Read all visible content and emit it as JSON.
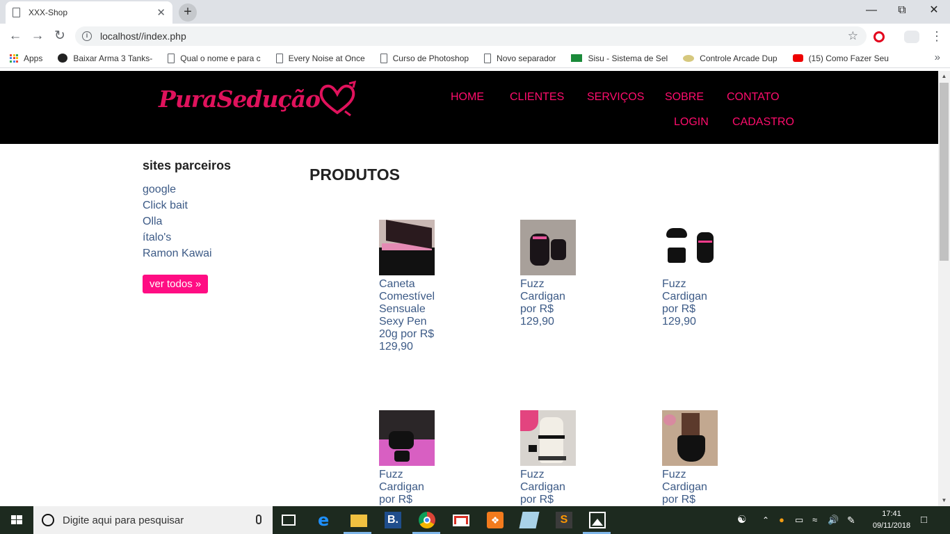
{
  "browser": {
    "tab_title": "XXX-Shop",
    "tab_close": "✕",
    "new_tab": "+",
    "url": "localhost//index.php",
    "bookmarks": [
      {
        "label": "Apps",
        "icon": "apps-icon"
      },
      {
        "label": "Baixar Arma 3 Tanks-",
        "icon": "skull-icon"
      },
      {
        "label": "Qual o nome e para c",
        "icon": "page-icon"
      },
      {
        "label": "Every Noise at Once",
        "icon": "page-icon"
      },
      {
        "label": "Curso de Photoshop",
        "icon": "page-icon"
      },
      {
        "label": "Novo separador",
        "icon": "page-icon"
      },
      {
        "label": "Sisu - Sistema de Sel",
        "icon": "flag-icon"
      },
      {
        "label": "Controle Arcade Dup",
        "icon": "gamepad-icon"
      },
      {
        "label": "(15) Como Fazer Seu",
        "icon": "youtube-icon"
      }
    ],
    "bookmarks_more": "»"
  },
  "site": {
    "logo_text": "PuraSedução",
    "nav": {
      "home": "HOME",
      "clientes": "CLIENTES",
      "servicos": "SERVIÇOS",
      "sobre": "SOBRE",
      "contato": "CONTATO",
      "login": "LOGIN",
      "cadastro": "CADASTRO"
    },
    "sidebar": {
      "title": "sites parceiros",
      "links": [
        "google",
        "Click bait",
        "Olla",
        "ítalo's",
        "Ramon Kawai"
      ],
      "button": "ver todos »"
    },
    "products_title": "PRODUTOS",
    "products": [
      {
        "name": "Caneta Comestível Sensuale Sexy Pen 20g por R$ 129,90"
      },
      {
        "name": "Fuzz Cardigan por R$ 129,90"
      },
      {
        "name": "Fuzz Cardigan por R$ 129,90"
      },
      {
        "name": "Fuzz Cardigan por R$"
      },
      {
        "name": "Fuzz Cardigan por R$"
      },
      {
        "name": "Fuzz Cardigan por R$"
      }
    ]
  },
  "taskbar": {
    "search_placeholder": "Digite aqui para pesquisar",
    "time": "17:41",
    "date": "09/11/2018"
  },
  "colors": {
    "accent_pink": "#ff0d6d",
    "header_bg": "#000000",
    "link_blue": "#3c5a86"
  }
}
